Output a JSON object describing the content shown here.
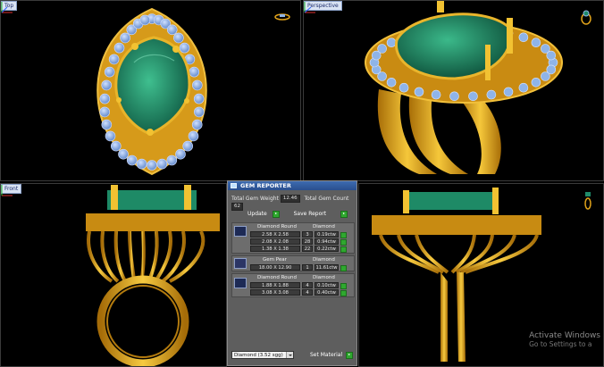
{
  "viewports": {
    "top": {
      "label": "Top"
    },
    "perspective": {
      "label": "Perspective"
    },
    "front": {
      "label": "Front"
    },
    "right": {
      "label": ""
    }
  },
  "gem_reporter": {
    "title": "GEM REPORTER",
    "total_weight_label": "Total Gem Weight",
    "total_weight_value": "12.46",
    "total_count_label": "Total Gem Count",
    "total_count_value": "62",
    "update_label": "Update",
    "save_report_label": "Save Report",
    "groups": [
      {
        "shape": "Diamond Round",
        "material": "Diamond",
        "rows": [
          {
            "size": "2.58 X 2.58",
            "count": "3",
            "weight": "0.19ctw"
          },
          {
            "size": "2.08 X 2.08",
            "count": "28",
            "weight": "0.94ctw"
          },
          {
            "size": "1.38 X 1.38",
            "count": "22",
            "weight": "0.22ctw"
          }
        ]
      },
      {
        "shape": "Gem Pear",
        "material": "Diamond",
        "rows": [
          {
            "size": "18.00 X 12.90",
            "count": "1",
            "weight": "11.61ctw"
          }
        ]
      },
      {
        "shape": "Diamond Round",
        "material": "Diamond",
        "rows": [
          {
            "size": "1.88 X 1.88",
            "count": "4",
            "weight": "0.10ctw"
          },
          {
            "size": "3.08 X 3.08",
            "count": "4",
            "weight": "0.40ctw"
          }
        ]
      }
    ],
    "material_select": "Diamond    (3.52 sgg)",
    "set_material_label": "Set Material"
  },
  "watermark": {
    "line1": "Activate Windows",
    "line2": "Go to Settings to a"
  },
  "colors": {
    "gold": "#e0a21a",
    "gem_blue": "#8fb4e8",
    "emerald": "#1f8a6a"
  }
}
